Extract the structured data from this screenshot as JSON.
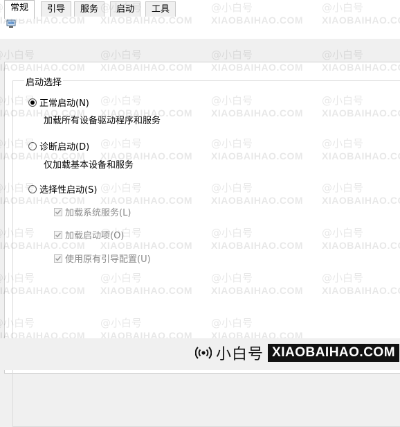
{
  "tabs": [
    "常规",
    "引导",
    "服务",
    "启动",
    "工具"
  ],
  "active_tab": "常规",
  "group_label": "启动选择",
  "options": [
    {
      "label": "正常启动(N)",
      "description": "加载所有设备驱动程序和服务",
      "selected": true
    },
    {
      "label": "诊断启动(D)",
      "description": "仅加载基本设备和服务",
      "selected": false
    },
    {
      "label": "选择性启动(S)",
      "description": "",
      "selected": false
    }
  ],
  "selective_items": [
    {
      "label": "加载系统服务(L)",
      "checked": true,
      "enabled": false
    },
    {
      "label": "加载启动项(O)",
      "checked": true,
      "enabled": false
    },
    {
      "label": "使用原有引导配置(U)",
      "checked": true,
      "enabled": false
    }
  ],
  "watermark": {
    "handle": "@小白号",
    "domain": "XIAOBAIHAO.COM"
  },
  "brand": {
    "name": "小白号",
    "url": "XIAOBAIHAO.COM"
  }
}
